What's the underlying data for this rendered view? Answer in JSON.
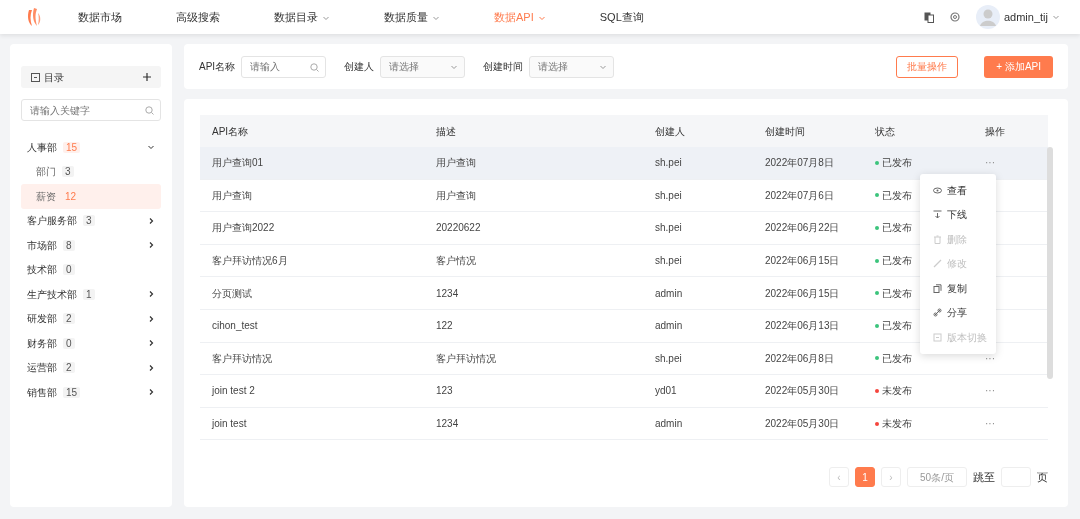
{
  "navbar": {
    "items": [
      {
        "label": "数据市场",
        "selected": false,
        "dropdown": false
      },
      {
        "label": "高级搜索",
        "selected": false,
        "dropdown": false
      },
      {
        "label": "数据目录",
        "selected": false,
        "dropdown": true
      },
      {
        "label": "数据质量",
        "selected": false,
        "dropdown": true
      },
      {
        "label": "数据API",
        "selected": true,
        "dropdown": true
      },
      {
        "label": "SQL查询",
        "selected": false,
        "dropdown": false
      }
    ],
    "user": "admin_tij"
  },
  "sidebar": {
    "title": "目录",
    "search_placeholder": "请输入关键字",
    "tree": [
      {
        "label": "人事部",
        "count": "15",
        "expandable": true,
        "expanded": true,
        "selected": false,
        "children": [
          {
            "label": "部门",
            "count": "3",
            "selected": false
          },
          {
            "label": "薪资",
            "count": "12",
            "selected": true
          }
        ]
      },
      {
        "label": "客户服务部",
        "count": "3",
        "expandable": true,
        "expanded": false,
        "selected": false
      },
      {
        "label": "市场部",
        "count": "8",
        "expandable": true,
        "expanded": false,
        "selected": false
      },
      {
        "label": "技术部",
        "count": "0",
        "expandable": false,
        "expanded": false,
        "selected": false
      },
      {
        "label": "生产技术部",
        "count": "1",
        "expandable": true,
        "expanded": false,
        "selected": false
      },
      {
        "label": "研发部",
        "count": "2",
        "expandable": true,
        "expanded": false,
        "selected": false
      },
      {
        "label": "财务部",
        "count": "0",
        "expandable": true,
        "expanded": false,
        "selected": false
      },
      {
        "label": "运营部",
        "count": "2",
        "expandable": true,
        "expanded": false,
        "selected": false
      },
      {
        "label": "销售部",
        "count": "15",
        "expandable": true,
        "expanded": false,
        "selected": false
      }
    ]
  },
  "filters": [
    {
      "label": "API名称",
      "placeholder": "请输入",
      "kind": "search"
    },
    {
      "label": "创建人",
      "placeholder": "请选择",
      "kind": "select"
    },
    {
      "label": "创建时间",
      "placeholder": "请选择",
      "kind": "select"
    }
  ],
  "buttons": {
    "batch": "批量操作",
    "add_icon": "+",
    "add": "添加API"
  },
  "table": {
    "columns": [
      "API名称",
      "描述",
      "创建人",
      "创建时间",
      "状态",
      "操作"
    ],
    "rows": [
      {
        "name": "用户查询01",
        "desc": "用户查询",
        "creator": "sh.pei",
        "time": "2022年07月8日",
        "status": "已发布",
        "published": true,
        "selected": true,
        "action": "···"
      },
      {
        "name": "用户查询",
        "desc": "用户查询",
        "creator": "sh.pei",
        "time": "2022年07月6日",
        "status": "已发布",
        "published": true,
        "selected": false
      },
      {
        "name": "用户查询2022",
        "desc": "20220622",
        "creator": "sh.pei",
        "time": "2022年06月22日",
        "status": "已发布",
        "published": true,
        "selected": false
      },
      {
        "name": "客户拜访情况6月",
        "desc": "客户情况",
        "creator": "sh.pei",
        "time": "2022年06月15日",
        "status": "已发布",
        "published": true,
        "selected": false
      },
      {
        "name": "分页测试",
        "desc": "1234",
        "creator": "admin",
        "time": "2022年06月15日",
        "status": "已发布",
        "published": true,
        "selected": false
      },
      {
        "name": "cihon_test",
        "desc": "122",
        "creator": "admin",
        "time": "2022年06月13日",
        "status": "已发布",
        "published": true,
        "selected": false
      },
      {
        "name": "客户拜访情况",
        "desc": "客户拜访情况",
        "creator": "sh.pei",
        "time": "2022年06月8日",
        "status": "已发布",
        "published": true,
        "selected": false,
        "action": "···"
      },
      {
        "name": "join test 2",
        "desc": "123",
        "creator": "yd01",
        "time": "2022年05月30日",
        "status": "未发布",
        "published": false,
        "selected": false,
        "action": "···"
      },
      {
        "name": "join test",
        "desc": "1234",
        "creator": "admin",
        "time": "2022年05月30日",
        "status": "未发布",
        "published": false,
        "selected": false,
        "action": "···"
      }
    ]
  },
  "context_menu": [
    {
      "label": "查看",
      "disabled": false,
      "kind": "eye"
    },
    {
      "label": "下线",
      "disabled": false,
      "kind": "offline"
    },
    {
      "label": "删除",
      "disabled": true,
      "kind": "trash"
    },
    {
      "label": "修改",
      "disabled": true,
      "kind": "pencil"
    },
    {
      "label": "复制",
      "disabled": false,
      "kind": "copy"
    },
    {
      "label": "分享",
      "disabled": false,
      "kind": "link"
    },
    {
      "label": "版本切换",
      "disabled": true,
      "kind": "version"
    }
  ],
  "pagination": {
    "prev": "‹",
    "pages": [
      {
        "label": "1",
        "selected": true
      }
    ],
    "next": "›",
    "page_size": "50条/页",
    "jump": "跳至",
    "unit": "页"
  }
}
